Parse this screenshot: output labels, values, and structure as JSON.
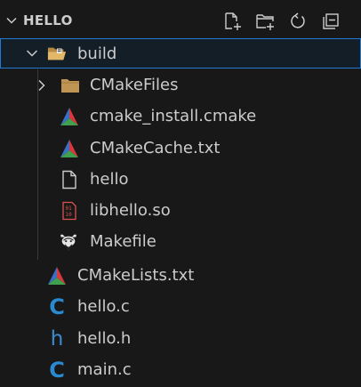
{
  "explorer": {
    "title": "HELLO",
    "actions": [
      {
        "name": "new-file",
        "icon": "new-file-icon"
      },
      {
        "name": "new-folder",
        "icon": "new-folder-icon"
      },
      {
        "name": "refresh",
        "icon": "refresh-icon"
      },
      {
        "name": "collapse-all",
        "icon": "collapse-all-icon"
      }
    ]
  },
  "tree": {
    "build": {
      "label": "build",
      "icon": "folder-open-icon",
      "expanded": true,
      "selected": true
    },
    "cmakefiles": {
      "label": "CMakeFiles",
      "icon": "folder-icon",
      "expanded": false
    },
    "cmake_install": {
      "label": "cmake_install.cmake",
      "icon": "cmake-icon"
    },
    "cmakecache": {
      "label": "CMakeCache.txt",
      "icon": "cmake-icon"
    },
    "hello": {
      "label": "hello",
      "icon": "file-icon"
    },
    "libhello": {
      "label": "libhello.so",
      "icon": "binary-file-icon"
    },
    "makefile": {
      "label": "Makefile",
      "icon": "gnu-icon"
    },
    "cmakelists": {
      "label": "CMakeLists.txt",
      "icon": "cmake-icon"
    },
    "hello_c": {
      "label": "hello.c",
      "icon": "c-file-icon"
    },
    "hello_h": {
      "label": "hello.h",
      "icon": "h-file-icon"
    },
    "main_c": {
      "label": "main.c",
      "icon": "c-file-icon"
    }
  },
  "colors": {
    "background": "#181818",
    "text": "#cccccc",
    "selection_border": "#1f7ad6",
    "folder": "#c09553",
    "c_blue": "#2a8ad1",
    "cmake_red": "#d9373b",
    "cmake_blue": "#3a6fc4",
    "cmake_green": "#3fa04d"
  }
}
